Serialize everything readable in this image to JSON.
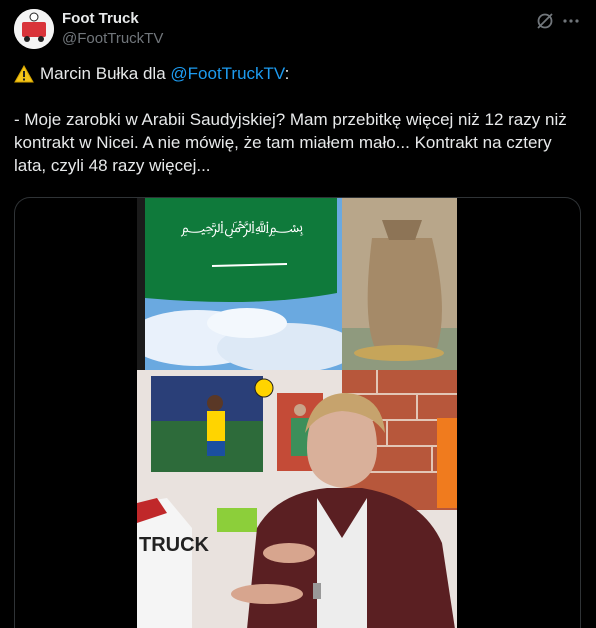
{
  "author": {
    "display_name": "Foot Truck",
    "handle": "@FootTruckTV",
    "avatar_logo_text": "FOOT TRUCK"
  },
  "header_icons": [
    "grok-icon",
    "more-icon"
  ],
  "tweet": {
    "warning_emoji": "warning-icon",
    "intro_prefix": "Marcin Bułka dla ",
    "mention": "@FootTruckTV",
    "intro_suffix": ":",
    "body": "- Moje zarobki w Arabii Saudyjskiej? Mam przebitkę więcej niż 12 razy niż kontrakt w Nicei. A nie mówię, że tam miałem mało... Kontrakt na cztery lata, czyli 48 razy więcej..."
  },
  "media": {
    "kind": "video-thumbnail",
    "shirt_text": "TRUCK"
  },
  "colors": {
    "background": "#000000",
    "text": "#e7e9ea",
    "secondary": "#71767b",
    "link": "#1d9bf0",
    "flag_green": "#0f7a3b"
  }
}
